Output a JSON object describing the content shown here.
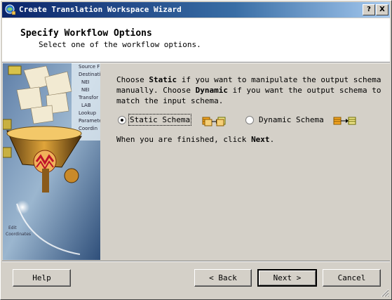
{
  "window": {
    "title": "Create Translation Workspace Wizard",
    "help_glyph": "?",
    "close_glyph": "X"
  },
  "header": {
    "title": "Specify Workflow Options",
    "subtitle": "Select one of the workflow options."
  },
  "side_panel": {
    "list_items": [
      "Source F",
      "Destinati",
      "NEI",
      "NEI",
      "Transfor",
      "LAB",
      "Lookup",
      "Paramete",
      "Coordin"
    ],
    "footer": [
      "Edit",
      "Coordinates"
    ]
  },
  "body": {
    "para_parts": [
      "Choose ",
      "Static",
      " if you want to manipulate the output schema manually. Choose ",
      "Dynamic",
      " if you want the output schema to match the input schema."
    ],
    "finish_parts": [
      "When you are finished, click ",
      "Next",
      "."
    ]
  },
  "options": {
    "static_label": "Static Schema",
    "dynamic_label": "Dynamic Schema",
    "selected": "static"
  },
  "buttons": {
    "help": "Help",
    "back": "< Back",
    "next": "Next >",
    "cancel": "Cancel"
  },
  "colors": {
    "titlebar_start": "#0a246a",
    "titlebar_end": "#a6caf0",
    "dialog_bg": "#d4d0c8",
    "schema_orange": "#f5a623"
  }
}
